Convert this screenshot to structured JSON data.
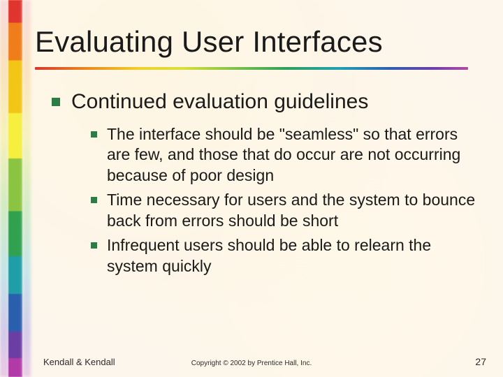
{
  "title": "Evaluating User Interfaces",
  "level1": "Continued evaluation guidelines",
  "level2": [
    "The interface should be \"seamless\" so that errors are few, and those that do occur are not occurring because of poor design",
    "Time necessary for users and the system to bounce back from errors should be short",
    "Infrequent users should be able to relearn the system quickly"
  ],
  "footer": {
    "author": "Kendall & Kendall",
    "copyright": "Copyright © 2002 by Prentice Hall, Inc.",
    "page": "27"
  }
}
